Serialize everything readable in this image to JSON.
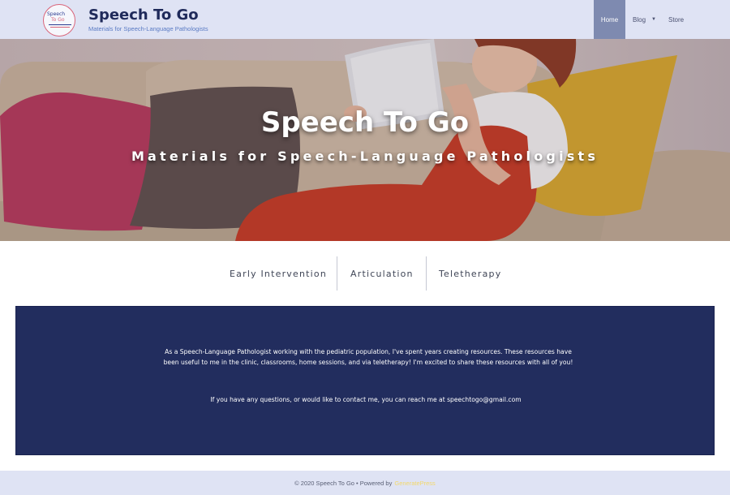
{
  "header": {
    "logo": {
      "line1": "Speech",
      "line2": "To Go"
    },
    "title": "Speech To Go",
    "tagline": "Materials for Speech-Language Pathologists"
  },
  "nav": {
    "items": [
      {
        "label": "Home",
        "active": true
      },
      {
        "label": "Blog",
        "has_dropdown": true
      },
      {
        "label": "Store"
      }
    ]
  },
  "hero": {
    "title": "Speech To Go",
    "subtitle": "Materials for Speech-Language Pathologists"
  },
  "categories": [
    {
      "label": "Early Intervention"
    },
    {
      "label": "Articulation"
    },
    {
      "label": "Teletherapy"
    }
  ],
  "intro": {
    "paragraph1": "As a Speech-Language Pathologist working with the pediatric population, I've spent years creating resources. These resources have been useful to me in the clinic, classrooms, home sessions, and via teletherapy! I'm excited to share these resources with all of you!",
    "paragraph2": "If you have any questions, or would like to contact me, you can reach me at speechtogo@gmail.com"
  },
  "footer": {
    "text": "© 2020 Speech To Go • Powered by",
    "link": "GeneratePress"
  },
  "colors": {
    "header_bg": "#dfe3f4",
    "nav_active_bg": "#7e8ab0",
    "title_navy": "#1f2a5a",
    "intro_bg": "#222d5e",
    "footer_link": "#f3d86a"
  }
}
